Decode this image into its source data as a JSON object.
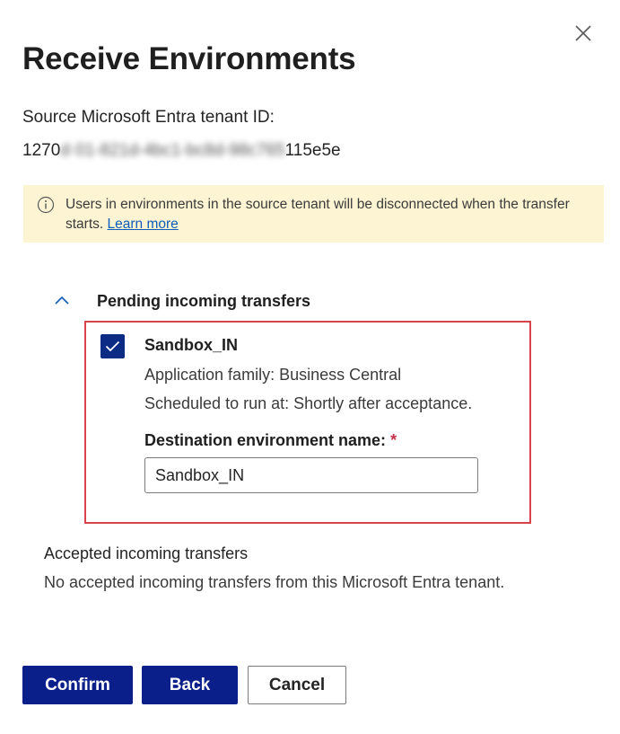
{
  "dialog": {
    "title": "Receive Environments",
    "close_icon": "close-icon"
  },
  "source": {
    "label": "Source Microsoft Entra tenant ID:",
    "tenant_id_prefix": "1270",
    "tenant_id_redacted": "d·01-821d-4bc1-bc8d-98c765",
    "tenant_id_suffix": "115e5e"
  },
  "banner": {
    "icon": "info-icon",
    "message": "Users in environments in the source tenant will be disconnected when the transfer starts.",
    "link_text": "Learn more",
    "background": "#fcf4d2"
  },
  "pending": {
    "section_title": "Pending incoming transfers",
    "chevron_icon": "chevron-up-icon",
    "items": [
      {
        "checked": true,
        "name": "Sandbox_IN",
        "app_family": "Application family: Business Central",
        "schedule": "Scheduled to run at: Shortly after acceptance.",
        "dest_label": "Destination environment name:",
        "required_mark": "*",
        "dest_value": "Sandbox_IN"
      }
    ]
  },
  "accepted": {
    "section_title": "Accepted incoming transfers",
    "message": "No accepted incoming transfers from this Microsoft Entra tenant."
  },
  "buttons": {
    "confirm": "Confirm",
    "back": "Back",
    "cancel": "Cancel"
  },
  "colors": {
    "primary": "#0b1f8a",
    "highlight_border": "#d9434c",
    "link": "#0f5cb8"
  }
}
